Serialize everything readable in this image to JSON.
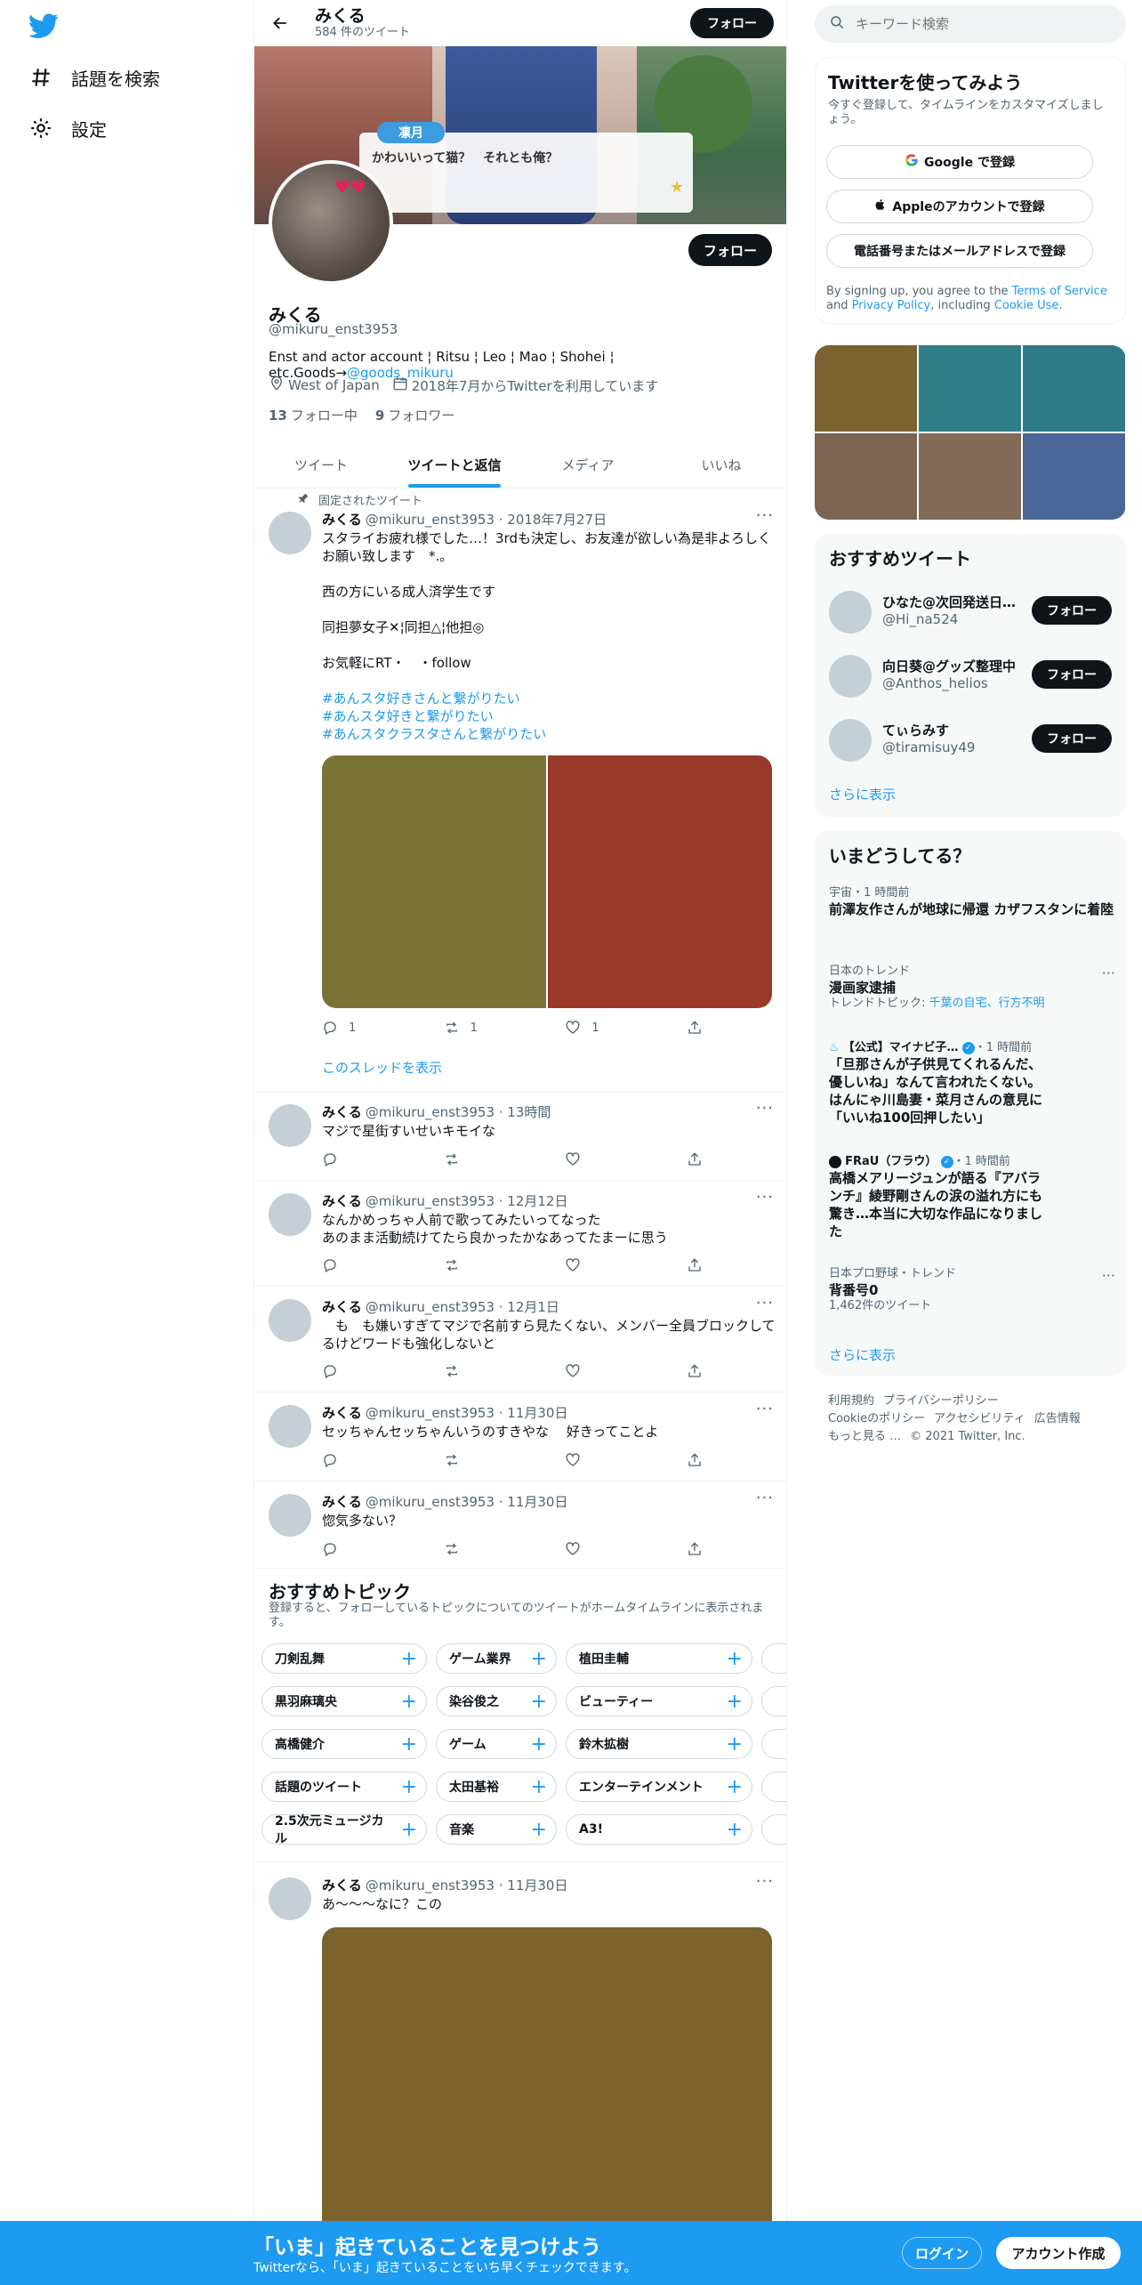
{
  "nav": {
    "explore_label": "話題を検索",
    "settings_label": "設定"
  },
  "topbar": {
    "name": "みくる",
    "tweet_count": "584 件のツイート",
    "follow_label": "フォロー"
  },
  "banner": {
    "character_name": "凛月",
    "dialog_text": "かわいいって猫？　それとも俺？"
  },
  "profile": {
    "follow_label": "フォロー",
    "name": "みくる",
    "handle": "@mikuru_enst3953",
    "bio_text": "Enst and actor account ¦ Ritsu ¦ Leo ¦ Mao ¦ Shohei ¦ etc.Goods→",
    "bio_link": "@goods_mikuru",
    "location": "West of Japan",
    "joined": "2018年7月からTwitterを利用しています",
    "following_count": "13",
    "following_label": "フォロー中",
    "followers_count": "9",
    "followers_label": "フォロワー"
  },
  "tabs": [
    "ツイート",
    "ツイートと返信",
    "メディア",
    "いいね"
  ],
  "pinned": {
    "label": "固定されたツイート",
    "name": "みくる",
    "meta": "@mikuru_enst3953 · 2018年7月27日",
    "lines": [
      "スタライお疲れ様でした…！3rdも決定し、お友達が欲しい為是非よろしくお願い致します　*.｡",
      "西の方にいる成人済学生です",
      "同担夢女子✕¦同担△¦他担◎",
      "お気軽にRT・　・follow"
    ],
    "hashtags": [
      "#あんスタ好きさんと繋がりたい",
      "#あんスタ好きと繋がりたい",
      "#あんスタクラスタさんと繋がりたい"
    ],
    "reply_count": "1",
    "retweet_count": "1",
    "like_count": "1",
    "thread_link": "このスレッドを表示"
  },
  "tweets": [
    {
      "name": "みくる",
      "meta": "@mikuru_enst3953 · 13時間",
      "text": "マジで星街すいせいキモイな"
    },
    {
      "name": "みくる",
      "meta": "@mikuru_enst3953 · 12月12日",
      "text": "なんかめっちゃ人前で歌ってみたいってなった\nあのまま活動続けてたら良かったかなあってたまーに思う"
    },
    {
      "name": "みくる",
      "meta": "@mikuru_enst3953 · 12月1日",
      "text": "　も　も嫌いすぎてマジで名前すら見たくない、メンバー全員ブロックしてるけどワードも強化しないと"
    },
    {
      "name": "みくる",
      "meta": "@mikuru_enst3953 · 11月30日",
      "text": "セッちゃんセッちゃんいうのすきやな　 好きってことよ"
    },
    {
      "name": "みくる",
      "meta": "@mikuru_enst3953 · 11月30日",
      "text": "惚気多ない？"
    },
    {
      "name": "みくる",
      "meta": "@mikuru_enst3953 · 11月30日",
      "text": "あ～～～なに？この"
    }
  ],
  "topics": {
    "title": "おすすめトピック",
    "subtitle": "登録すると、フォローしているトピックについてのツイートがホームタイムラインに表示されます。",
    "rows": [
      [
        "刀剣乱舞",
        "ゲーム業界",
        "植田圭輔"
      ],
      [
        "黒羽麻璃央",
        "染谷俊之",
        "ビューティー"
      ],
      [
        "高橋健介",
        "ゲーム",
        "鈴木拡樹"
      ],
      [
        "話題のツイート",
        "太田基裕",
        "エンターテインメント"
      ],
      [
        "2.5次元ミュージカル",
        "音楽",
        "A3!"
      ]
    ]
  },
  "search": {
    "placeholder": "キーワード検索"
  },
  "signup": {
    "title": "Twitterを使ってみよう",
    "subtitle": "今すぐ登録して、タイムラインをカスタマイズしましょう。",
    "google": "Google で登録",
    "apple": "Appleのアカウントで登録",
    "phone": "電話番号またはメールアドレスで登録",
    "legal_1": "By signing up, you agree to the ",
    "legal_terms": "Terms of Service",
    "legal_2": " and ",
    "legal_privacy": "Privacy Policy",
    "legal_3": ", including ",
    "legal_cookie": "Cookie Use",
    "legal_4": "."
  },
  "recs": {
    "title": "おすすめツイート",
    "items": [
      {
        "name": "ひなた@次回発送日…",
        "handle": "@Hi_na524",
        "btn": "フォロー"
      },
      {
        "name": "向日葵@グッズ整理中",
        "handle": "@Anthos_helios",
        "btn": "フォロー"
      },
      {
        "name": "てぃらみす",
        "handle": "@tiramisuy49",
        "btn": "フォロー"
      }
    ],
    "more": "さらに表示"
  },
  "trends": {
    "title": "いまどうしてる？",
    "items": [
      {
        "meta": "宇宙・1 時間前",
        "title": "前澤友作さんが地球に帰還 カザフスタンに着陸"
      },
      {
        "meta": "日本のトレンド",
        "title": "漫画家逮捕",
        "sub": "トレンドトピック: ",
        "sub_link": "千葉の自宅、行方不明"
      },
      {
        "source": "【公式】マイナビ子…",
        "time": "・1 時間前",
        "title": "「旦那さんが子供見てくれるんだ、優しいね」なんて言われたくない。はんにゃ川島妻・菜月さんの意見に「いいね100回押したい」"
      },
      {
        "source": "FRaU（フラウ）",
        "time": "・1 時間前",
        "title": "高橋メアリージュンが語る『アバランチ』綾野剛さんの涙の溢れ方にも驚き…本当に大切な作品になりました"
      },
      {
        "meta": "日本プロ野球・トレンド",
        "title": "背番号0",
        "sub": "1,462件のツイート"
      }
    ],
    "more": "さらに表示"
  },
  "footer": [
    "利用規約",
    "プライバシーポリシー",
    "Cookieのポリシー",
    "アクセシビリティ",
    "広告情報",
    "もっと見る …",
    "© 2021 Twitter, Inc."
  ],
  "bottombar": {
    "title": "「いま」起きていることを見つけよう",
    "subtitle": "Twitterなら、「いま」起きていることをいち早くチェックできます。",
    "login": "ログイン",
    "signup": "アカウント作成"
  },
  "colors": {
    "accent": "#1d9bf0",
    "dark": "#0f1419"
  }
}
